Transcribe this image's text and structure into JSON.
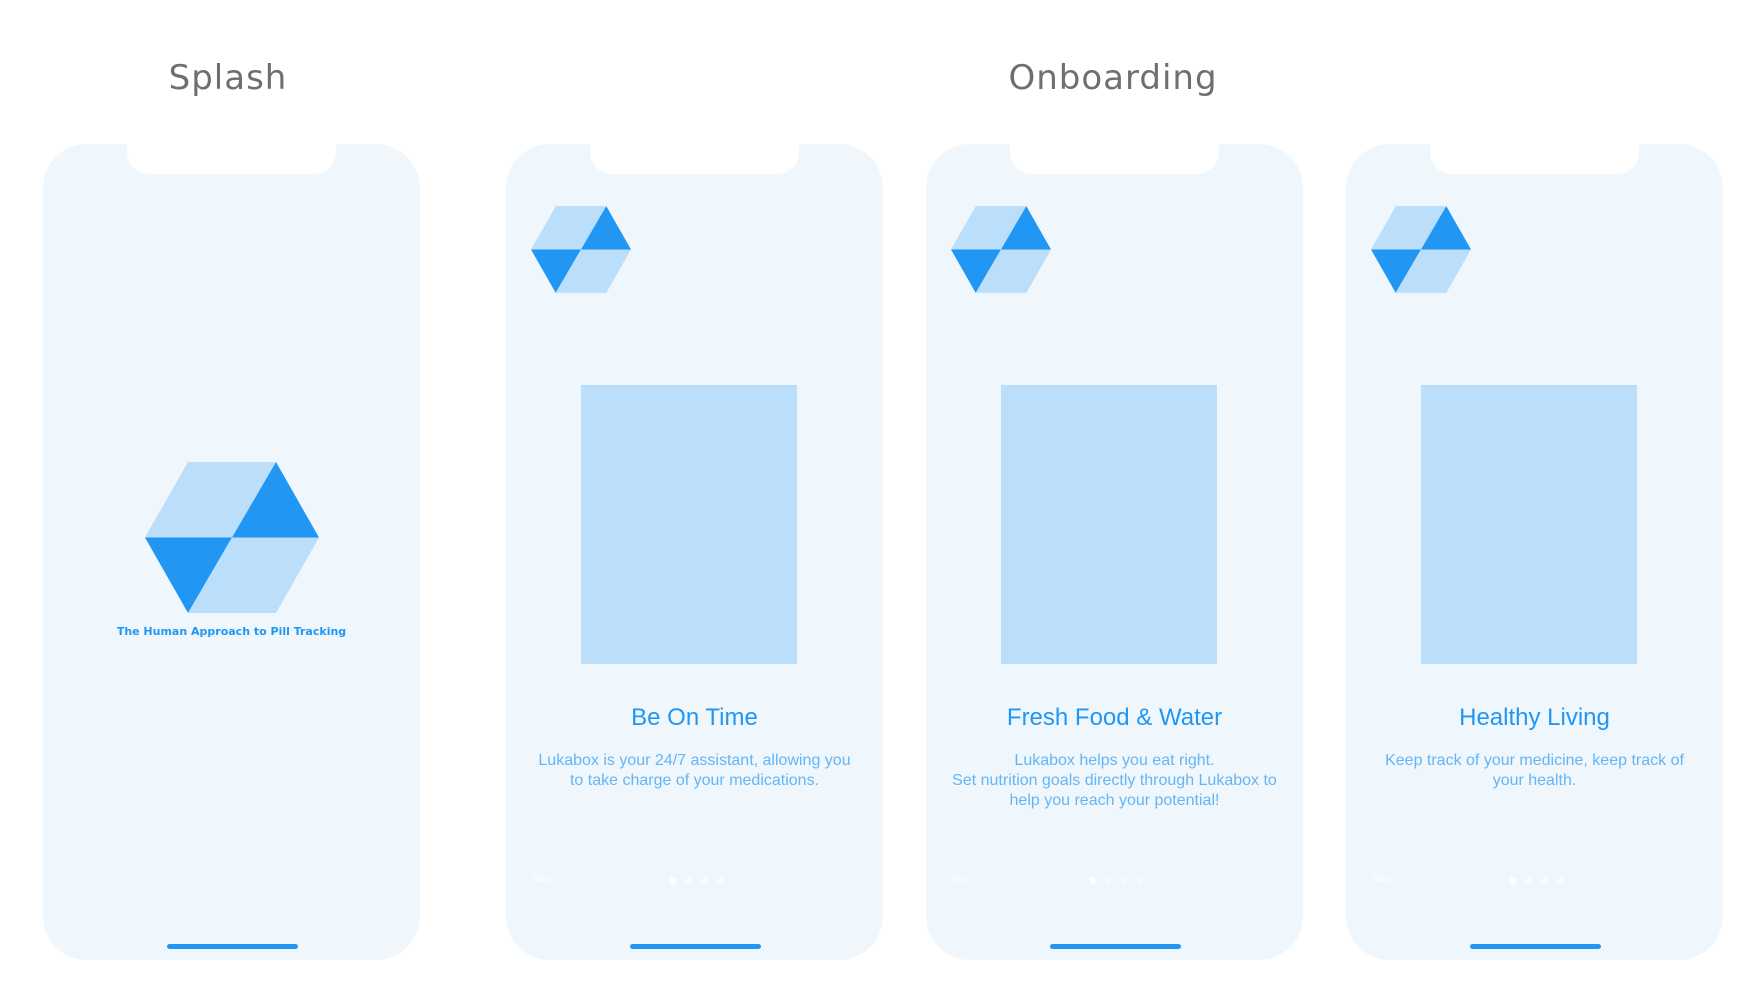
{
  "colors": {
    "phone_bg": "#eff7fd",
    "accent": "#2196f3",
    "accent_light": "#bbdefb",
    "body_text": "#64b5f6",
    "heading_gray": "#6f6f6f"
  },
  "sections": {
    "splash_title": "Splash",
    "onboarding_title": "Onboarding"
  },
  "splash": {
    "tagline": "The Human Approach to Pill Tracking",
    "logo_icon": "hexagon-logo-icon"
  },
  "onboarding": {
    "skip_label": "Skip",
    "slides": [
      {
        "title": "Be On Time",
        "text_lines": [
          "Lukabox is your 24/7 assistant, allowing you",
          "to take charge of your medications."
        ],
        "active_page": 1,
        "page_count": 4
      },
      {
        "title": "Fresh Food & Water",
        "text_lines": [
          "Lukabox helps you eat right.",
          "Set nutrition goals directly through Lukabox to",
          "help you reach your potential!"
        ],
        "active_page": 1,
        "page_count": 4
      },
      {
        "title": "Healthy Living",
        "text_lines": [
          "Keep track of your medicine, keep track of",
          "your health."
        ],
        "active_page": 1,
        "page_count": 4
      }
    ]
  }
}
